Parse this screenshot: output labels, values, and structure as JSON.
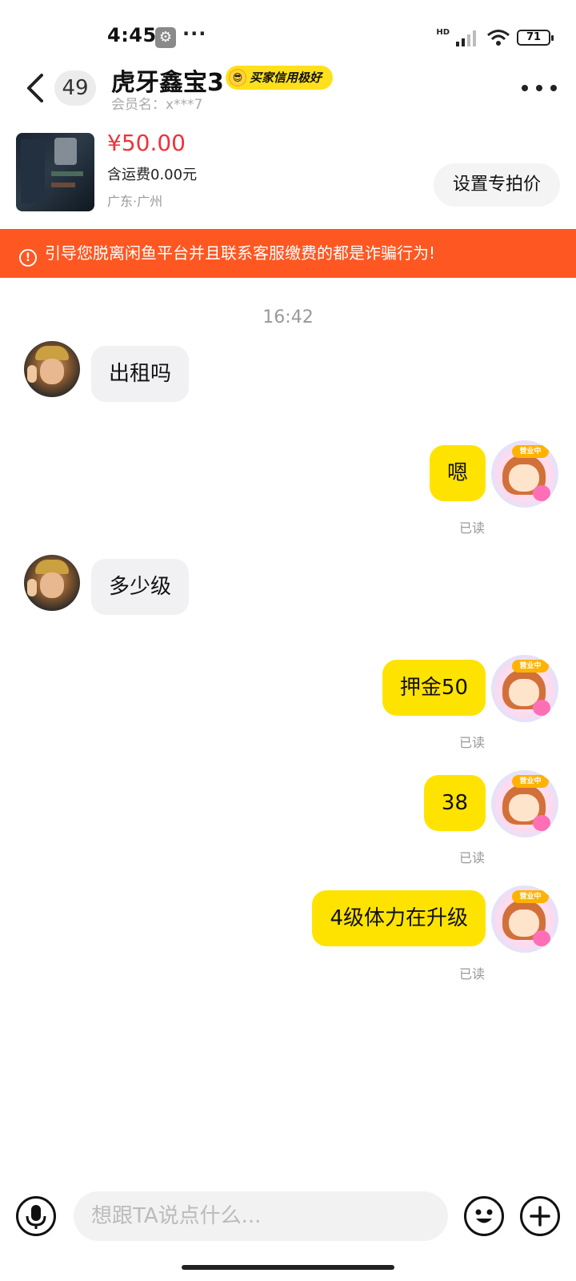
{
  "status_bar": {
    "time": "4:45",
    "more": "···",
    "signal_label": "HD",
    "battery": "71"
  },
  "header": {
    "unread_count": "49",
    "title": "虎牙鑫宝3",
    "credit_badge": "买家信用极好",
    "member_name": "会员名：x***7"
  },
  "product": {
    "price": "¥50.00",
    "shipping": "含运费0.00元",
    "location": "广东·广州",
    "set_price_label": "设置专拍价"
  },
  "warning": {
    "text": "引导您脱离闲鱼平台并且联系客服缴费的都是诈骗行为!"
  },
  "chat": {
    "timestamp": "16:42",
    "avatar_tag": "营业中",
    "messages": [
      {
        "side": "left",
        "text": "出租吗"
      },
      {
        "side": "right",
        "text": "嗯",
        "status": "已读"
      },
      {
        "side": "left",
        "text": "多少级"
      },
      {
        "side": "right",
        "text": "押金50",
        "status": "已读"
      },
      {
        "side": "right",
        "text": "38",
        "status": "已读"
      },
      {
        "side": "right",
        "text": "4级体力在升级",
        "status": "已读"
      }
    ]
  },
  "input": {
    "placeholder": "想跟TA说点什么..."
  },
  "colors": {
    "accent": "#ffe300",
    "warning_bg": "#ff5722",
    "price": "#f0323c"
  },
  "icons": {
    "back": "chevron-left-icon",
    "menu": "more-horizontal-icon",
    "voice": "microphone-icon",
    "emoji": "smiley-icon",
    "plus": "plus-icon"
  }
}
